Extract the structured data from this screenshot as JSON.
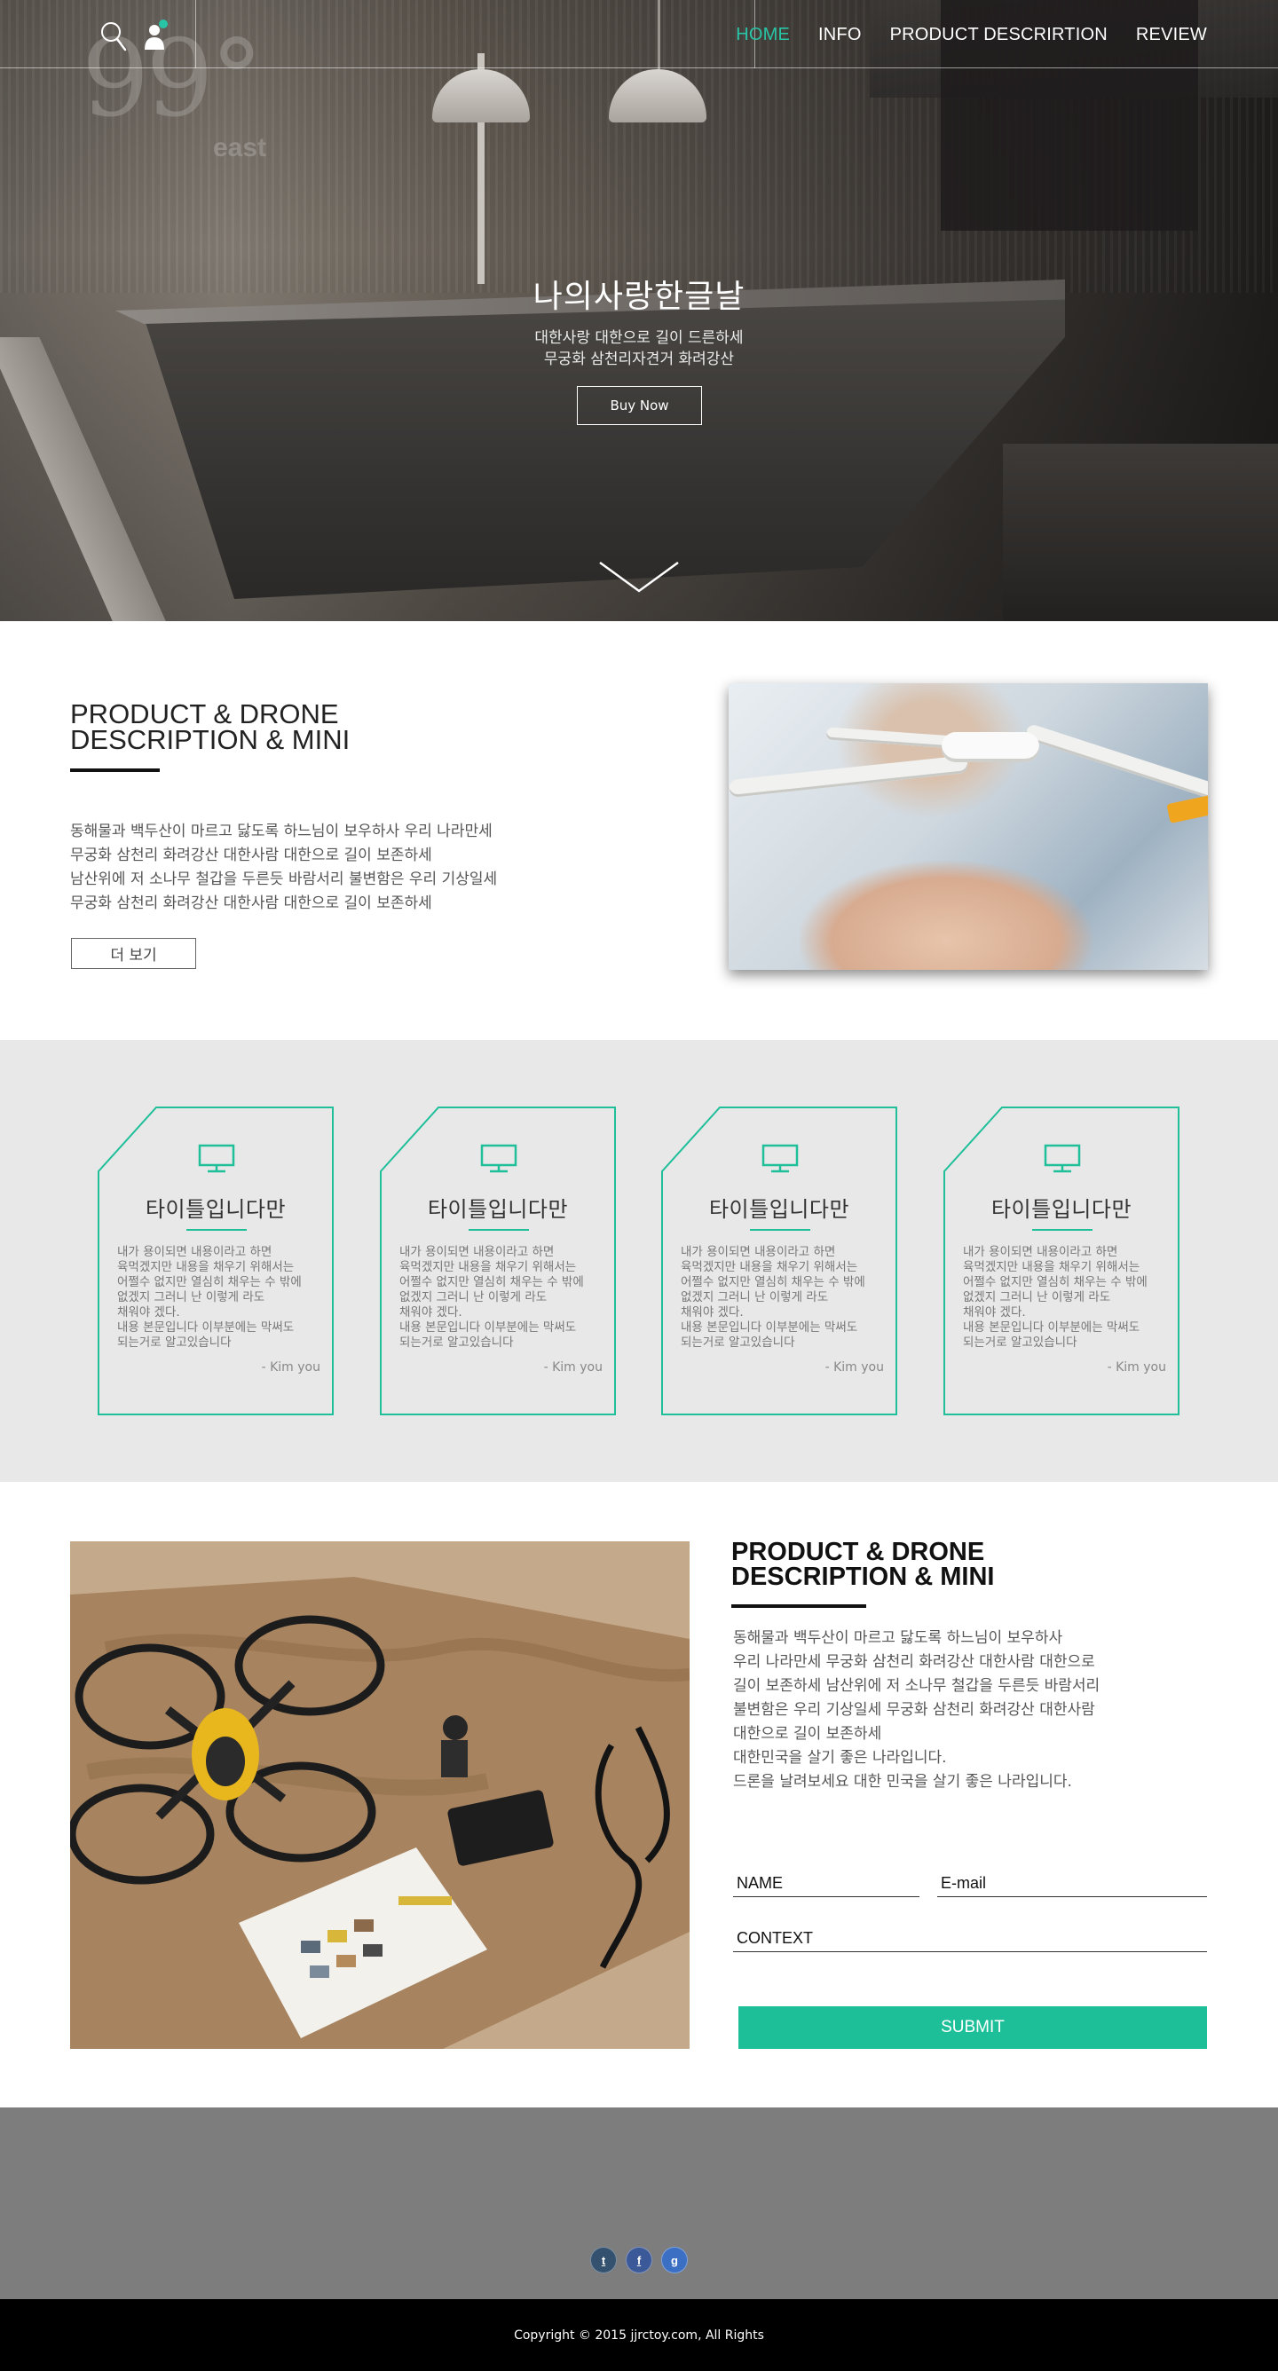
{
  "nav": {
    "items": [
      "HOME",
      "INFO",
      "PRODUCT DESCRIRTION",
      "REVIEW"
    ],
    "active_color": "#28c4a6"
  },
  "hero": {
    "logo_number": "99°",
    "logo_word": "east",
    "title": "나의사랑한글날",
    "subtitle_line1": "대한사랑 대한으로 길이 드른하세",
    "subtitle_line2": "무궁화 삼천리자견거 화려강산",
    "button": "Buy Now"
  },
  "section1": {
    "title_line1": "PRODUCT & DRONE",
    "title_line2": "DESCRIPTION & MINI",
    "body": [
      "동해물과 백두산이 마르고 닳도록 하느님이 보우하사 우리 나라만세",
      "무궁화 삼천리 화려강산 대한사람 대한으로 길이 보존하세",
      "남산위에 저  소나무 철갑을 두른듯 바람서리 불변함은 우리 기상일세",
      "무궁화 삼천리 화려강산 대한사람 대한으로 길이 보존하세"
    ],
    "button": "더 보기"
  },
  "cards": [
    {
      "title": "타이틀입니다만",
      "body": [
        "내가 용이되면 내용이라고 하면",
        "육먹겠지만 내용을 채우기 위해서는",
        "어쩔수 없지만 열심히 채우는 수 밖에",
        "없겠지 그러니 난 이렇게 라도",
        "채워야 겠다.",
        "내용 본문입니다 이부분에는 막써도",
        "되는거로 알고있습니다"
      ],
      "author": "- Kim you"
    },
    {
      "title": "타이틀입니다만",
      "body": [
        "내가 용이되면 내용이라고 하면",
        "육먹겠지만 내용을 채우기 위해서는",
        "어쩔수 없지만 열심히 채우는 수 밖에",
        "없겠지 그러니 난 이렇게 라도",
        "채워야 겠다.",
        "내용 본문입니다 이부분에는 막써도",
        "되는거로 알고있습니다"
      ],
      "author": "- Kim you"
    },
    {
      "title": "타이틀입니다만",
      "body": [
        "내가 용이되면 내용이라고 하면",
        "육먹겠지만 내용을 채우기 위해서는",
        "어쩔수 없지만 열심히 채우는 수 밖에",
        "없겠지 그러니 난 이렇게 라도",
        "채워야 겠다.",
        "내용 본문입니다 이부분에는 막써도",
        "되는거로 알고있습니다"
      ],
      "author": "- Kim you"
    },
    {
      "title": "타이틀입니다만",
      "body": [
        "내가 용이되면 내용이라고 하면",
        "육먹겠지만 내용을 채우기 위해서는",
        "어쩔수 없지만 열심히 채우는 수 밖에",
        "없겠지 그러니 난 이렇게 라도",
        "채워야 겠다.",
        "내용 본문입니다 이부분에는 막써도",
        "되는거로 알고있습니다"
      ],
      "author": "- Kim you"
    }
  ],
  "section2": {
    "title_line1": "PRODUCT & DRONE",
    "title_line2": "DESCRIPTION & MINI",
    "body": [
      "동해물과 백두산이 마르고 닳도록 하느님이 보우하사",
      "우리 나라만세 무궁화 삼천리 화려강산 대한사람 대한으로",
      "길이 보존하세 남산위에 저  소나무 철갑을 두른듯 바람서리",
      "불변함은 우리 기상일세 무궁화 삼천리 화려강산 대한사람",
      "대한으로 길이 보존하세",
      "대한민국을 살기 좋은 나라입니다.",
      "드론을 날려보세요 대한 민국을 살기 좋은 나라입니다."
    ],
    "form": {
      "name_label": "NAME",
      "email_label": "E-mail",
      "context_label": "CONTEXT",
      "submit": "SUBMIT"
    },
    "accent_color": "#1dbf99"
  },
  "footer": {
    "social": [
      {
        "glyph": "t",
        "icon": "tumblr-icon",
        "color": "#34526f"
      },
      {
        "glyph": "f",
        "icon": "facebook-icon",
        "color": "#3b5998"
      },
      {
        "glyph": "g",
        "icon": "google-plus-icon",
        "color": "#3a6fc4"
      }
    ],
    "copyright": "Copyright © 2015 jjrctoy.com, All Rights"
  }
}
